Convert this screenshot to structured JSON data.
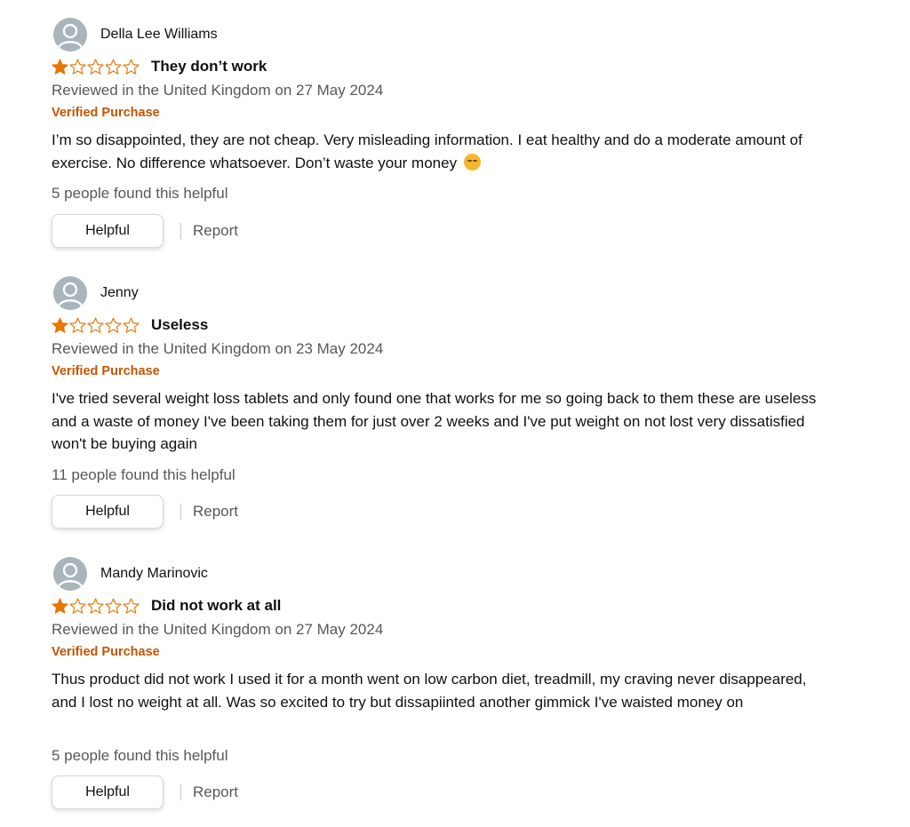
{
  "colors": {
    "star_filled": "#e77600",
    "star_outline": "#e77600",
    "verified": "#c45500",
    "muted_text": "#565959",
    "avatar_bg": "#a9b4bb"
  },
  "reviews": [
    {
      "reviewer": "Della Lee Williams",
      "rating": 1,
      "max_rating": 5,
      "title": "They don’t work",
      "date": "Reviewed in the United Kingdom on 27 May 2024",
      "verified": "Verified Purchase",
      "body": "I’m so disappointed, they are not cheap. Very misleading information. I eat healthy and do a moderate amount of exercise. No difference whatsoever. Don’t waste your money",
      "emoji": "pensive-face-emoji",
      "helpful_count": "5 people found this helpful",
      "helpful_label": "Helpful",
      "report_label": "Report"
    },
    {
      "reviewer": "Jenny",
      "rating": 1,
      "max_rating": 5,
      "title": "Useless",
      "date": "Reviewed in the United Kingdom on 23 May 2024",
      "verified": "Verified Purchase",
      "body": "I've tried several weight loss tablets and only found one that works for me so going back to them these are useless and a waste of money I've been taking them for just over 2 weeks and I've put weight on not lost very dissatisfied won't be buying again",
      "helpful_count": "11 people found this helpful",
      "helpful_label": "Helpful",
      "report_label": "Report"
    },
    {
      "reviewer": "Mandy Marinovic",
      "rating": 1,
      "max_rating": 5,
      "title": "Did not work at all",
      "date": "Reviewed in the United Kingdom on 27 May 2024",
      "verified": "Verified Purchase",
      "body": "Thus product did not work I used it for a month went on low carbon diet, treadmill, my craving never disappeared, and I lost no weight at all. Was so excited to try but dissapiinted another gimmick I've waisted money on",
      "helpful_count": "5 people found this helpful",
      "helpful_label": "Helpful",
      "report_label": "Report"
    }
  ]
}
